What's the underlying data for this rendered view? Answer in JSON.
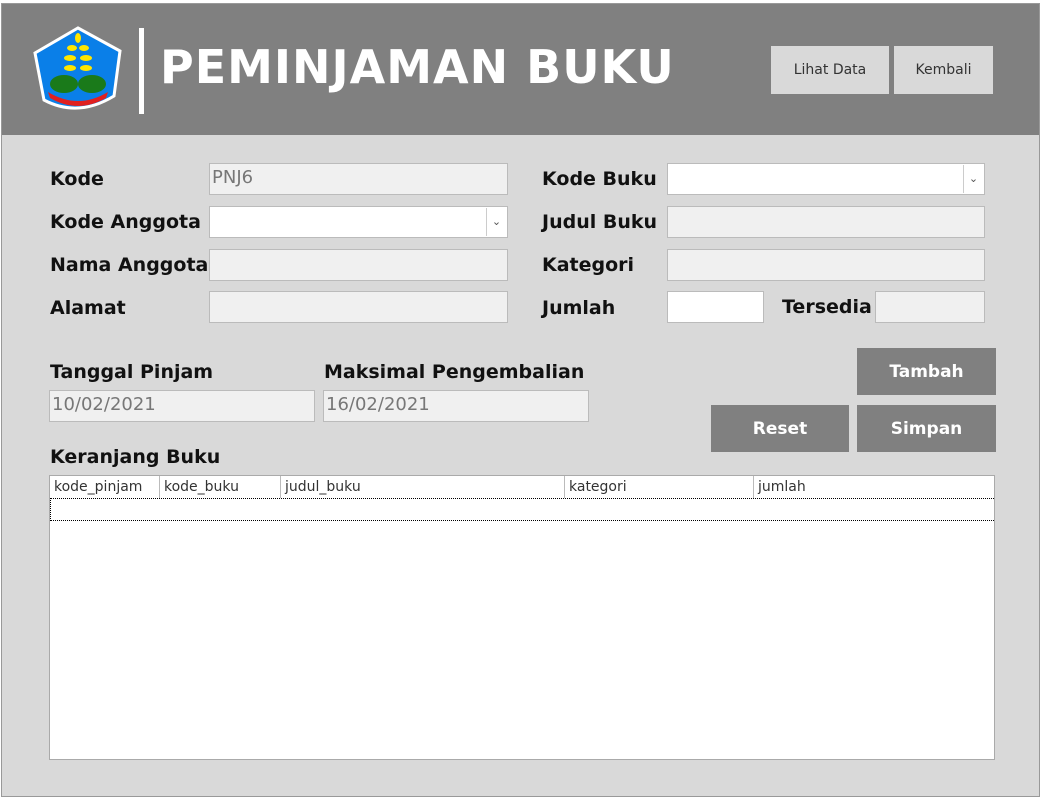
{
  "header": {
    "title": "PEMINJAMAN BUKU",
    "lihat_data": "Lihat Data",
    "kembali": "Kembali"
  },
  "form": {
    "kode_label": "Kode",
    "kode_value": "PNJ6",
    "kode_anggota_label": "Kode Anggota",
    "kode_anggota_value": "",
    "nama_anggota_label": "Nama Anggota",
    "nama_anggota_value": "",
    "alamat_label": "Alamat",
    "alamat_value": "",
    "kode_buku_label": "Kode Buku",
    "kode_buku_value": "",
    "judul_buku_label": "Judul Buku",
    "judul_buku_value": "",
    "kategori_label": "Kategori",
    "kategori_value": "",
    "jumlah_label": "Jumlah",
    "jumlah_value": "",
    "tersedia_label": "Tersedia",
    "tersedia_value": "",
    "tanggal_pinjam_label": "Tanggal Pinjam",
    "tanggal_pinjam_value": "10/02/2021",
    "maks_label": "Maksimal Pengembalian",
    "maks_value": "16/02/2021"
  },
  "buttons": {
    "tambah": "Tambah",
    "reset": "Reset",
    "simpan": "Simpan"
  },
  "cart": {
    "title": "Keranjang Buku",
    "columns": [
      "kode_pinjam",
      "kode_buku",
      "judul_buku",
      "kategori",
      "jumlah"
    ]
  }
}
